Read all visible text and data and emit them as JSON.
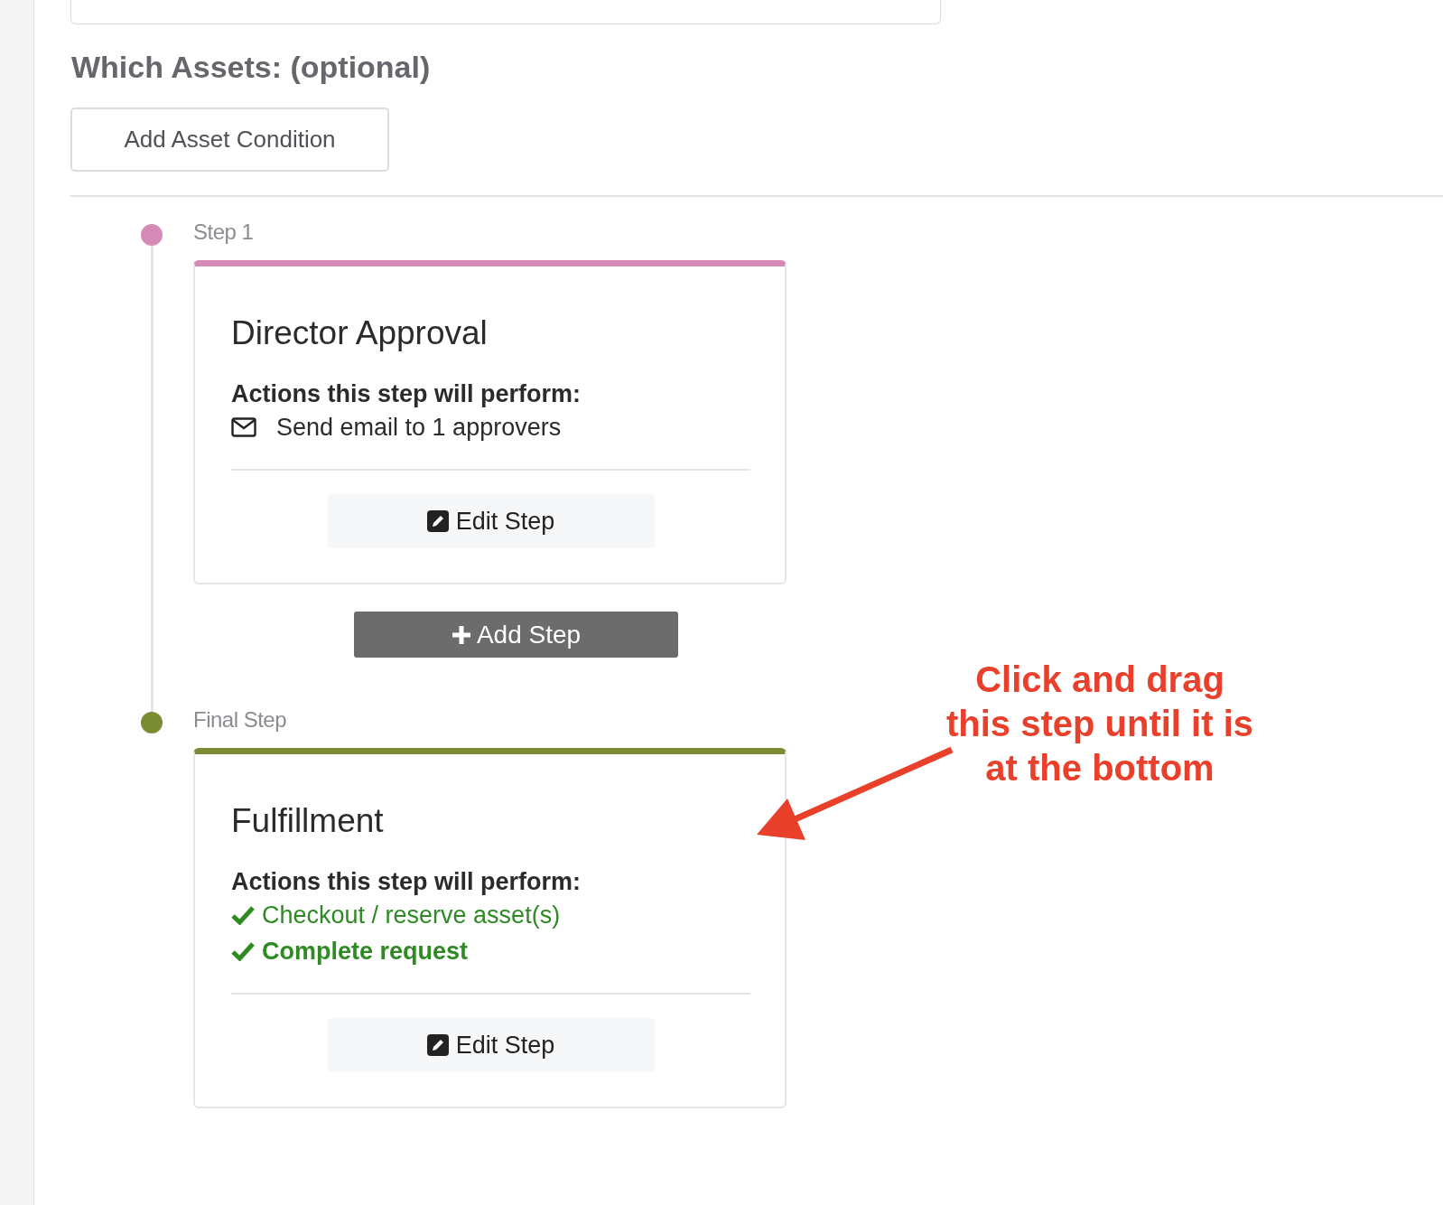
{
  "heading": "Which Assets: (optional)",
  "add_asset_button": "Add Asset Condition",
  "steps": [
    {
      "label": "Step 1",
      "color": "#d68ab7",
      "title": "Director Approval",
      "actions_heading": "Actions this step will perform:",
      "actions": [
        {
          "kind": "email",
          "text": "Send email to 1 approvers",
          "strong": false
        }
      ],
      "edit_button": "Edit Step"
    },
    {
      "label": "Final Step",
      "color": "#7b8c35",
      "title": "Fulfillment",
      "actions_heading": "Actions this step will perform:",
      "actions": [
        {
          "kind": "check",
          "text": "Checkout / reserve asset(s)",
          "strong": false
        },
        {
          "kind": "check",
          "text": "Complete request",
          "strong": true
        }
      ],
      "edit_button": "Edit Step"
    }
  ],
  "add_step_button": "Add Step",
  "annotation": {
    "text": "Click and drag\nthis step until it is\nat the bottom"
  }
}
